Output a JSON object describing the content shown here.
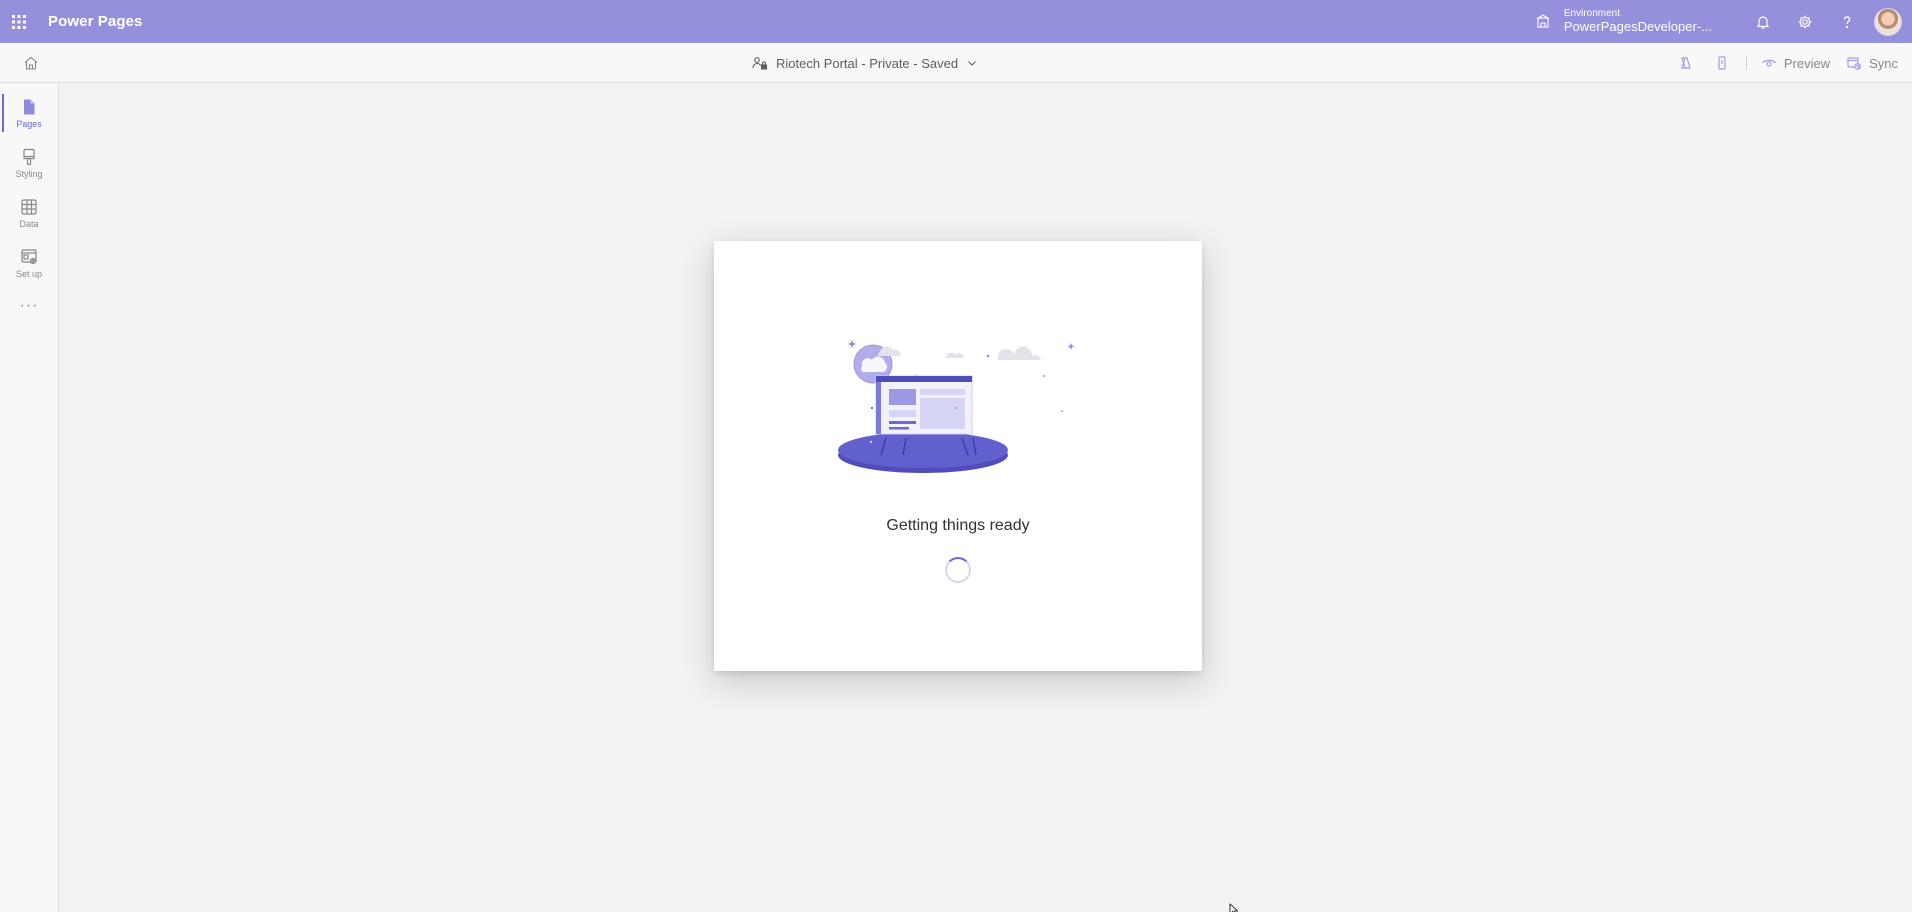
{
  "app": {
    "title": "Power Pages"
  },
  "topbar": {
    "environment_label": "Environment",
    "environment_name": "PowerPagesDeveloper-...",
    "icons": [
      "waffle-icon",
      "environment-icon",
      "bell-icon",
      "gear-icon",
      "help-icon",
      "avatar"
    ]
  },
  "cmdbar": {
    "site_status": "Riotech Portal - Private - Saved",
    "preview_label": "Preview",
    "sync_label": "Sync"
  },
  "rail": {
    "items": [
      {
        "label": "Pages",
        "icon": "page-icon",
        "active": true
      },
      {
        "label": "Styling",
        "icon": "brush-icon",
        "active": false
      },
      {
        "label": "Data",
        "icon": "table-icon",
        "active": false
      },
      {
        "label": "Set up",
        "icon": "setup-icon",
        "active": false
      }
    ],
    "more": "···"
  },
  "loading": {
    "title": "Getting things ready"
  },
  "colors": {
    "header_bg": "#9590dc",
    "accent": "#6b69d6",
    "canvas_bg": "#f3f2f1"
  }
}
